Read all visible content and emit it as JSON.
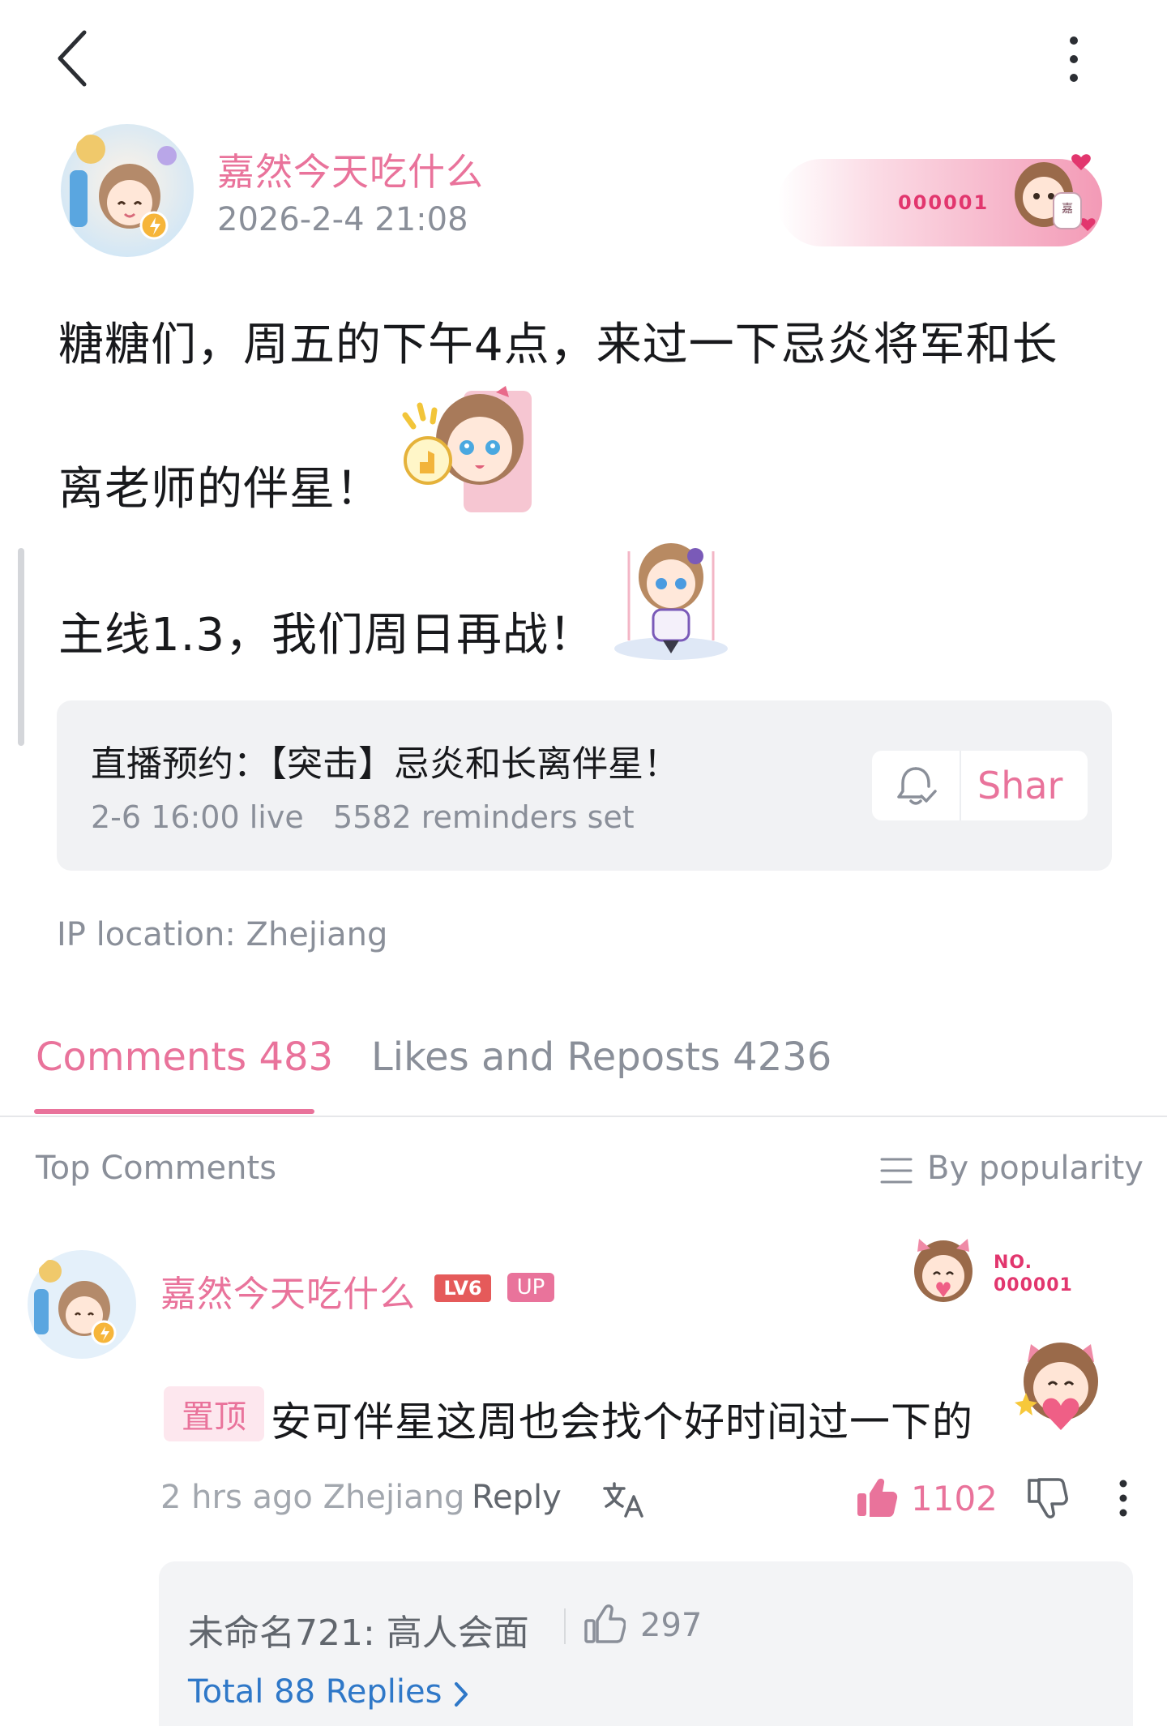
{
  "post": {
    "author_name": "嘉然今天吃什么",
    "timestamp": "2026-2-4 21:08",
    "fan_badge_number": "000001",
    "lines": [
      "糖糖们，周五的下午4点，来过一下忌炎将军和长",
      "离老师的伴星！",
      "主线1.3，我们周日再战！"
    ]
  },
  "reservation": {
    "title": "直播预约：【突击】忌炎和长离伴星！",
    "subtitle": "2-6 16:00 live   5582 reminders set",
    "share_label": "Shar"
  },
  "ip_location": "IP location: Zhejiang",
  "tabs": {
    "comments": "Comments 483",
    "likes_reposts": "Likes and Reposts 4236"
  },
  "comments_header": {
    "title": "Top Comments",
    "sort_label": "By popularity"
  },
  "comment": {
    "author_name": "嘉然今天吃什么",
    "level_badge": "LV6",
    "up_badge": "UP",
    "fan_mark_top": "NO.",
    "fan_mark_bottom": "000001",
    "pin_tag": "置顶",
    "text": "安可伴星这周也会找个好时间过一下的",
    "meta": "2 hrs ago Zhejiang",
    "reply_label": "Reply",
    "like_count": "1102",
    "sub_reply": {
      "text": "未命名721: 高人会面",
      "like_count": "297",
      "total_label": "Total 88 Replies"
    }
  },
  "colors": {
    "accent_pink": "#e9739b",
    "link_blue": "#2f78c8",
    "muted_gray": "#8a8f99"
  },
  "icons": [
    "back-icon",
    "more-vertical-icon",
    "bell-check-icon",
    "sort-icon",
    "translate-icon",
    "thumbs-up-icon",
    "thumbs-down-icon",
    "chevron-right-icon"
  ]
}
